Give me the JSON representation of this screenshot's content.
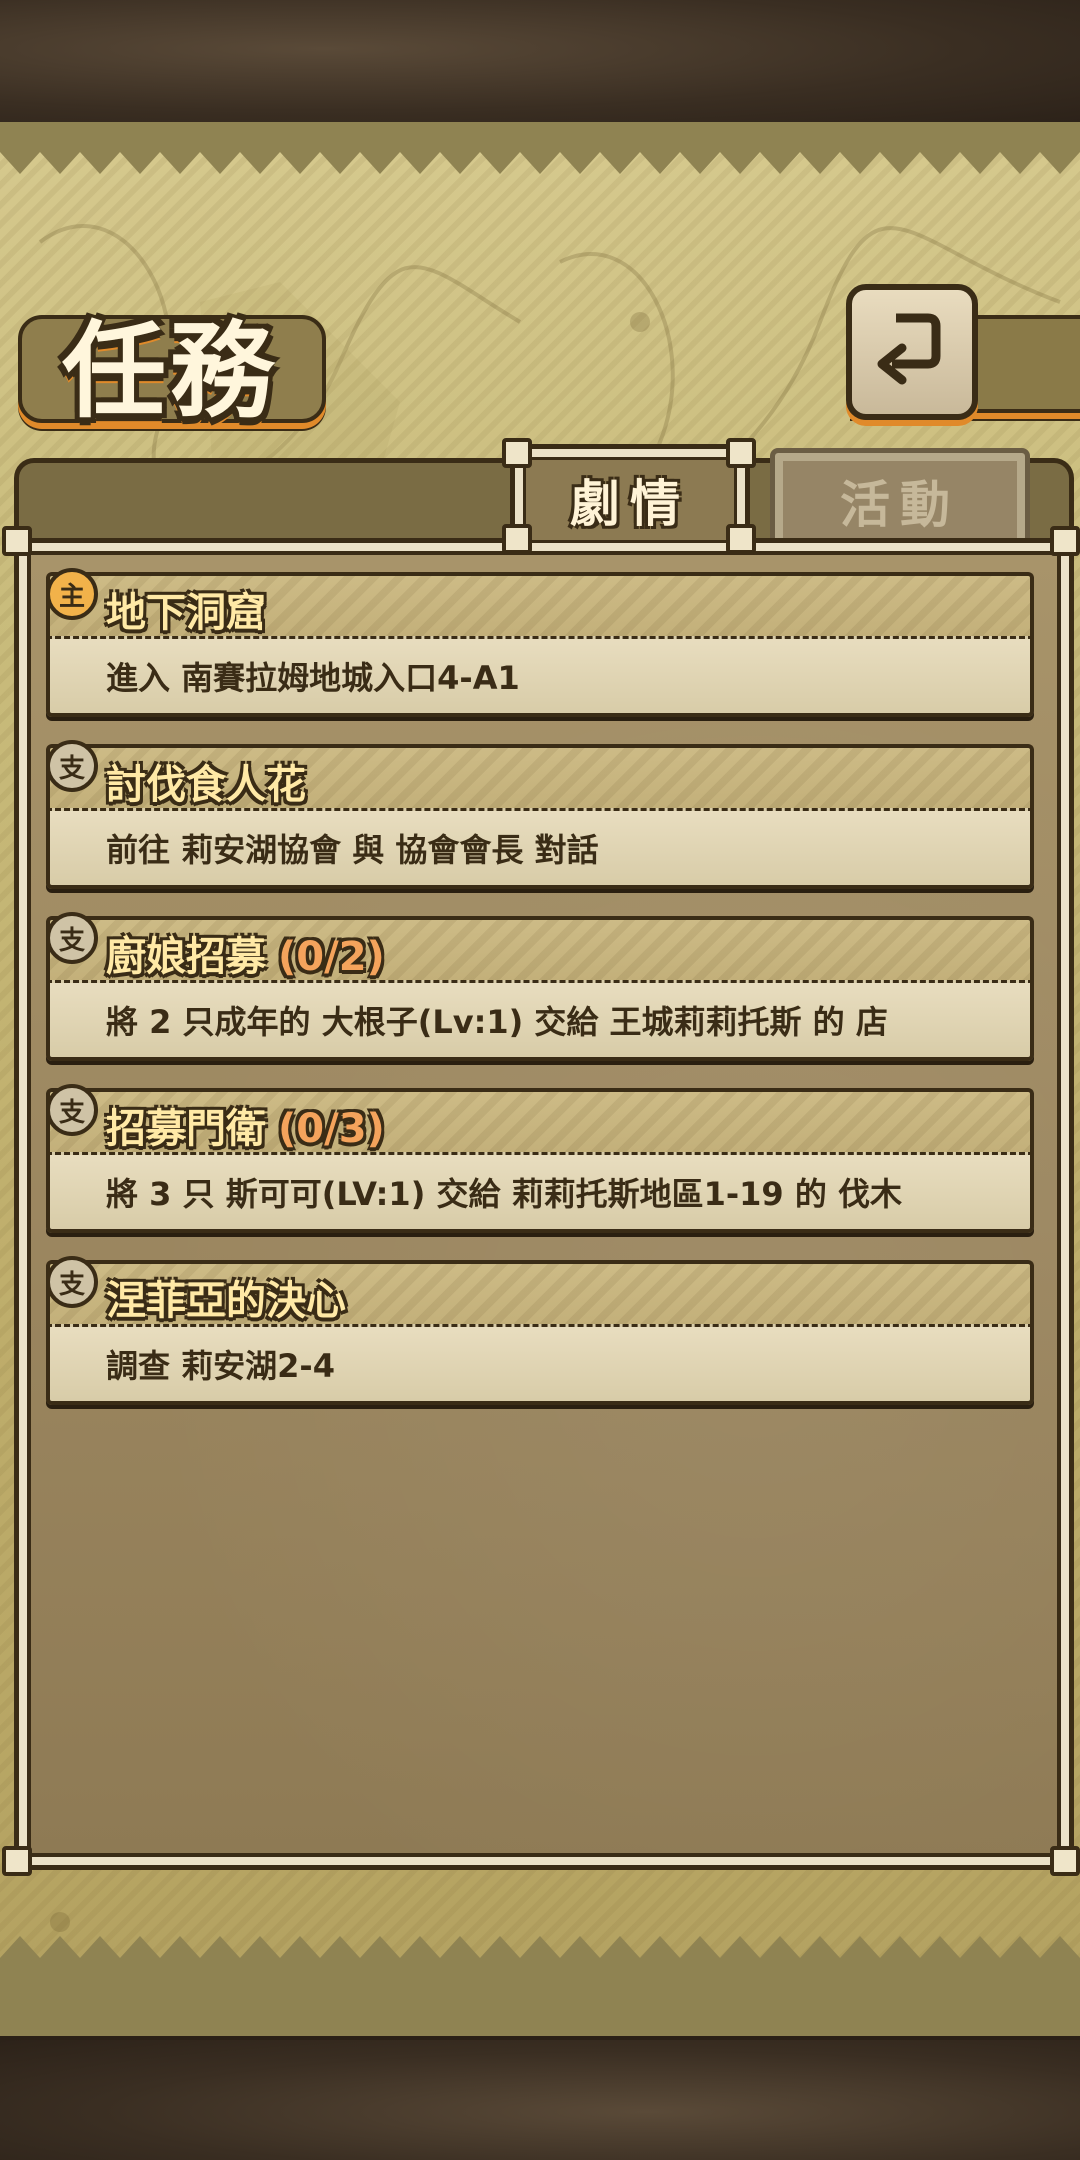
{
  "header": {
    "title": "任務"
  },
  "tabs": [
    {
      "label": "劇情",
      "active": true
    },
    {
      "label": "活動",
      "active": false
    }
  ],
  "quests": [
    {
      "icon": "主",
      "type": "main",
      "title": "地下洞窟",
      "progress": "",
      "desc": "進入 南賽拉姆地城入口4-A1"
    },
    {
      "icon": "支",
      "type": "side",
      "title": "討伐食人花",
      "progress": "",
      "desc": "前往 莉安湖協會 與 協會會長 對話"
    },
    {
      "icon": "支",
      "type": "side",
      "title": "廚娘招募",
      "progress": "(0/2)",
      "desc": "將 2 只成年的 大根子(Lv:1) 交給 王城莉莉托斯 的 店"
    },
    {
      "icon": "支",
      "type": "side",
      "title": "招募門衛",
      "progress": "(0/3)",
      "desc": "將 3 只 斯可可(LV:1) 交給 莉莉托斯地區1-19 的 伐木"
    },
    {
      "icon": "支",
      "type": "side",
      "title": "涅菲亞的決心",
      "progress": "",
      "desc": "調查 莉安湖2-4"
    }
  ],
  "colors": {
    "parchment": "#c9bc7c",
    "outline": "#3a2c16",
    "accent": "#e08a2a",
    "title_text": "#ffe9a6",
    "progress_text": "#f4a35c"
  }
}
